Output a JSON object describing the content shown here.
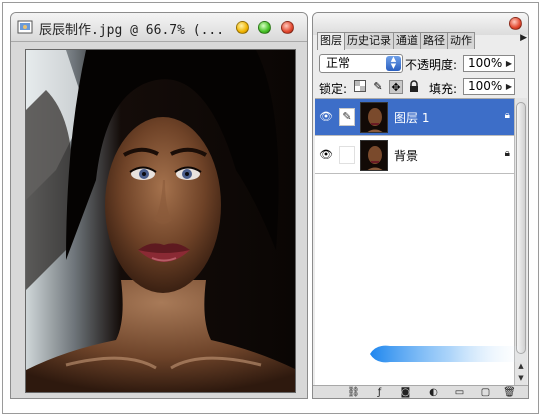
{
  "document": {
    "title": "辰辰制作.jpg @ 66.7% (..."
  },
  "panel": {
    "tabs": [
      {
        "label": "图层"
      },
      {
        "label": "历史记录"
      },
      {
        "label": "通道"
      },
      {
        "label": "路径"
      },
      {
        "label": "动作"
      }
    ],
    "blend_mode": "正常",
    "opacity_label": "不透明度:",
    "opacity_value": "100%",
    "lock_label": "锁定:",
    "fill_label": "填充:",
    "fill_value": "100%",
    "layers": [
      {
        "name": "图层 1",
        "selected": true
      },
      {
        "name": "背景",
        "selected": false
      }
    ]
  },
  "colors": {
    "selection": "#3d6ec8",
    "accent_arrow": "#2b8ff0"
  }
}
